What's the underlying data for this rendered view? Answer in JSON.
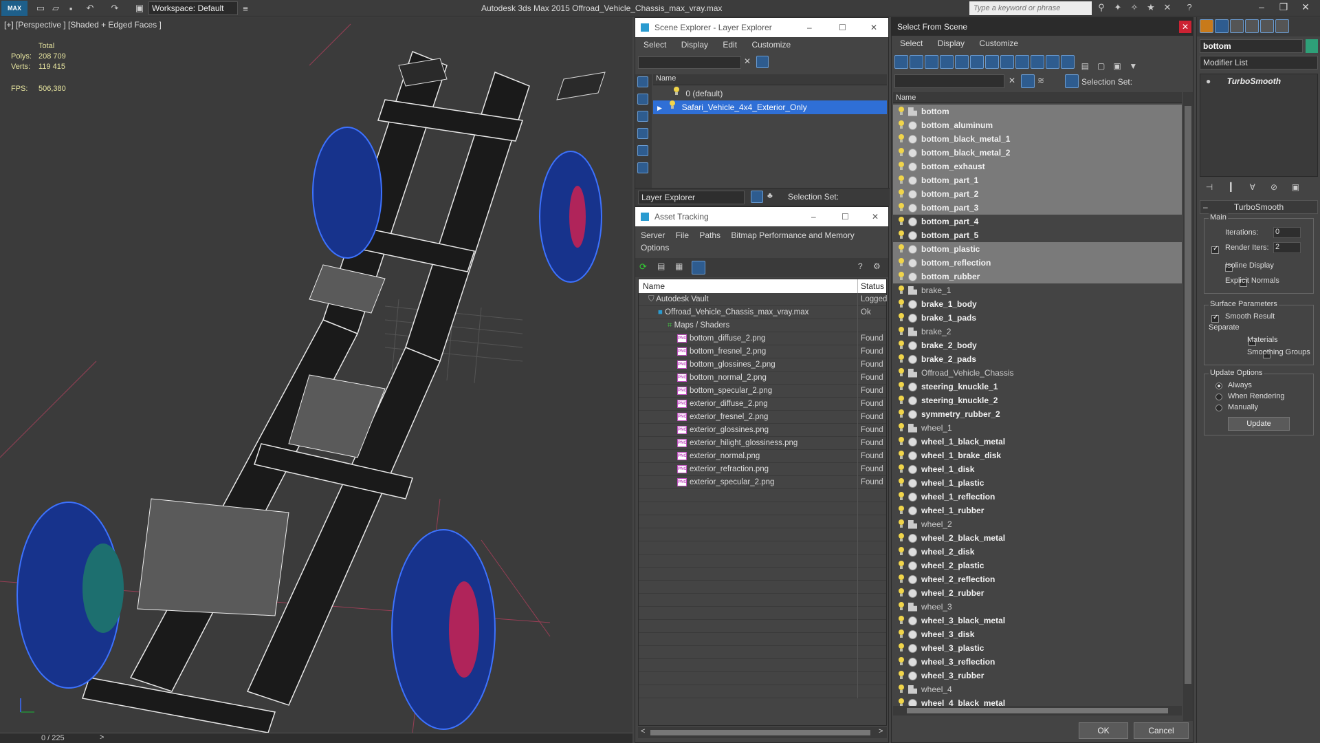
{
  "app": {
    "logo_text": "MAX",
    "workspace": "Workspace: Default",
    "window_title": "Autodesk 3ds Max  2015     Offroad_Vehicle_Chassis_max_vray.max",
    "search_placeholder": "Type a keyword or phrase"
  },
  "viewport": {
    "label": "[+] [Perspective ] [Shaded + Edged Faces ]",
    "stats_header": "Total",
    "polys_label": "Polys:",
    "polys_value": "208 709",
    "verts_label": "Verts:",
    "verts_value": "119 415",
    "fps_label": "FPS:",
    "fps_value": "506,380",
    "timeline": "0 / 225"
  },
  "scene_explorer": {
    "title": "Scene Explorer - Layer Explorer",
    "menu": [
      "Select",
      "Display",
      "Edit",
      "Customize"
    ],
    "column_name": "Name",
    "layers": [
      "0 (default)",
      "Safari_Vehicle_4x4_Exterior_Only"
    ],
    "footer_dropdown": "Layer Explorer",
    "selection_set_label": "Selection Set:"
  },
  "asset_tracking": {
    "title": "Asset Tracking",
    "menu": [
      "Server",
      "File",
      "Paths",
      "Bitmap Performance and Memory",
      "Options"
    ],
    "col_name": "Name",
    "col_status": "Status",
    "rows": [
      {
        "name": "Autodesk Vault",
        "status": "Logged",
        "indent": 1
      },
      {
        "name": "Offroad_Vehicle_Chassis_max_vray.max",
        "status": "Ok",
        "indent": 2
      },
      {
        "name": "Maps / Shaders",
        "status": "",
        "indent": 3
      },
      {
        "name": "bottom_diffuse_2.png",
        "status": "Found",
        "indent": 4
      },
      {
        "name": "bottom_fresnel_2.png",
        "status": "Found",
        "indent": 4
      },
      {
        "name": "bottom_glossines_2.png",
        "status": "Found",
        "indent": 4
      },
      {
        "name": "bottom_normal_2.png",
        "status": "Found",
        "indent": 4
      },
      {
        "name": "bottom_specular_2.png",
        "status": "Found",
        "indent": 4
      },
      {
        "name": "exterior_diffuse_2.png",
        "status": "Found",
        "indent": 4
      },
      {
        "name": "exterior_fresnel_2.png",
        "status": "Found",
        "indent": 4
      },
      {
        "name": "exterior_glossines.png",
        "status": "Found",
        "indent": 4
      },
      {
        "name": "exterior_hilight_glossiness.png",
        "status": "Found",
        "indent": 4
      },
      {
        "name": "exterior_normal.png",
        "status": "Found",
        "indent": 4
      },
      {
        "name": "exterior_refraction.png",
        "status": "Found",
        "indent": 4
      },
      {
        "name": "exterior_specular_2.png",
        "status": "Found",
        "indent": 4
      }
    ]
  },
  "select_from_scene": {
    "title": "Select From Scene",
    "menu": [
      "Select",
      "Display",
      "Customize"
    ],
    "selection_set_label": "Selection Set:",
    "column_name": "Name",
    "items": [
      {
        "name": "bottom",
        "kind": "group",
        "selected": true
      },
      {
        "name": "bottom_aluminum",
        "kind": "obj",
        "selected": true
      },
      {
        "name": "bottom_black_metal_1",
        "kind": "obj",
        "selected": true
      },
      {
        "name": "bottom_black_metal_2",
        "kind": "obj",
        "selected": true
      },
      {
        "name": "bottom_exhaust",
        "kind": "obj",
        "selected": true
      },
      {
        "name": "bottom_part_1",
        "kind": "obj",
        "selected": true
      },
      {
        "name": "bottom_part_2",
        "kind": "obj",
        "selected": true
      },
      {
        "name": "bottom_part_3",
        "kind": "obj",
        "selected": true
      },
      {
        "name": "bottom_part_4",
        "kind": "obj",
        "selected": false
      },
      {
        "name": "bottom_part_5",
        "kind": "obj",
        "selected": false
      },
      {
        "name": "bottom_plastic",
        "kind": "obj",
        "selected": true
      },
      {
        "name": "bottom_reflection",
        "kind": "obj",
        "selected": true
      },
      {
        "name": "bottom_rubber",
        "kind": "obj",
        "selected": true
      },
      {
        "name": "brake_1",
        "kind": "group",
        "selected": false
      },
      {
        "name": "brake_1_body",
        "kind": "obj",
        "selected": false
      },
      {
        "name": "brake_1_pads",
        "kind": "obj",
        "selected": false
      },
      {
        "name": "brake_2",
        "kind": "group",
        "selected": false
      },
      {
        "name": "brake_2_body",
        "kind": "obj",
        "selected": false
      },
      {
        "name": "brake_2_pads",
        "kind": "obj",
        "selected": false
      },
      {
        "name": "Offroad_Vehicle_Chassis",
        "kind": "group",
        "selected": false
      },
      {
        "name": "steering_knuckle_1",
        "kind": "obj",
        "selected": false
      },
      {
        "name": "steering_knuckle_2",
        "kind": "obj",
        "selected": false
      },
      {
        "name": "symmetry_rubber_2",
        "kind": "obj",
        "selected": false
      },
      {
        "name": "wheel_1",
        "kind": "group",
        "selected": false
      },
      {
        "name": "wheel_1_black_metal",
        "kind": "obj",
        "selected": false
      },
      {
        "name": "wheel_1_brake_disk",
        "kind": "obj",
        "selected": false
      },
      {
        "name": "wheel_1_disk",
        "kind": "obj",
        "selected": false
      },
      {
        "name": "wheel_1_plastic",
        "kind": "obj",
        "selected": false
      },
      {
        "name": "wheel_1_reflection",
        "kind": "obj",
        "selected": false
      },
      {
        "name": "wheel_1_rubber",
        "kind": "obj",
        "selected": false
      },
      {
        "name": "wheel_2",
        "kind": "group",
        "selected": false
      },
      {
        "name": "wheel_2_black_metal",
        "kind": "obj",
        "selected": false
      },
      {
        "name": "wheel_2_disk",
        "kind": "obj",
        "selected": false
      },
      {
        "name": "wheel_2_plastic",
        "kind": "obj",
        "selected": false
      },
      {
        "name": "wheel_2_reflection",
        "kind": "obj",
        "selected": false
      },
      {
        "name": "wheel_2_rubber",
        "kind": "obj",
        "selected": false
      },
      {
        "name": "wheel_3",
        "kind": "group",
        "selected": false
      },
      {
        "name": "wheel_3_black_metal",
        "kind": "obj",
        "selected": false
      },
      {
        "name": "wheel_3_disk",
        "kind": "obj",
        "selected": false
      },
      {
        "name": "wheel_3_plastic",
        "kind": "obj",
        "selected": false
      },
      {
        "name": "wheel_3_reflection",
        "kind": "obj",
        "selected": false
      },
      {
        "name": "wheel_3_rubber",
        "kind": "obj",
        "selected": false
      },
      {
        "name": "wheel_4",
        "kind": "group",
        "selected": false
      },
      {
        "name": "wheel_4_black_metal",
        "kind": "obj",
        "selected": false
      }
    ],
    "ok_label": "OK",
    "cancel_label": "Cancel"
  },
  "modify_panel": {
    "object_name": "bottom",
    "modifier_list": "Modifier List",
    "stack_item": "TurboSmooth",
    "rollout_title": "TurboSmooth",
    "main_label": "Main",
    "iterations_label": "Iterations:",
    "iterations_value": "0",
    "render_iters_label": "Render Iters:",
    "render_iters_value": "2",
    "isoline_label": "Isoline Display",
    "explicit_normals_label": "Explicit Normals",
    "surface_params_label": "Surface Parameters",
    "smooth_result_label": "Smooth Result",
    "separate_label": "Separate",
    "materials_label": "Materials",
    "smoothing_groups_label": "Smoothing Groups",
    "update_options_label": "Update Options",
    "always_label": "Always",
    "when_rendering_label": "When Rendering",
    "manually_label": "Manually",
    "update_button": "Update"
  },
  "colors": {
    "selection_blue": "#2f6fd6",
    "selected_row_gray": "#7a7a7a",
    "stats_yellow": "#e8e6a0",
    "wheel_blue": "#1f4fd6",
    "rim_pink": "#d02a6a"
  }
}
